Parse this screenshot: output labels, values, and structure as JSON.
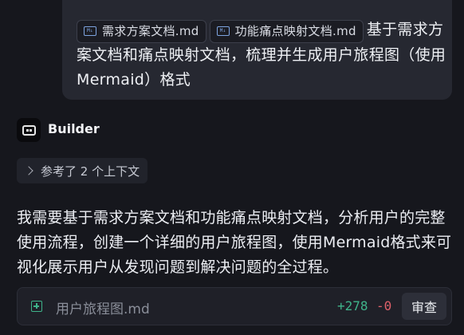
{
  "user_message": {
    "attachments": [
      {
        "icon": "markdown-file-icon",
        "name": "需求方案文档.md"
      },
      {
        "icon": "markdown-file-icon",
        "name": "功能痛点映射文档.md"
      }
    ],
    "text": "基于需求方案文档和痛点映射文档，梳理并生成用户旅程图（使用Mermaid）格式"
  },
  "assistant": {
    "name": "Builder",
    "avatar_icon": "robot-icon",
    "context_label": "参考了 2 个上下文",
    "response": "我需要基于需求方案文档和功能痛点映射文档，分析用户的完整使用流程，创建一个详细的用户旅程图，使用Mermaid格式来可视化展示用户从发现问题到解决问题的全过程。"
  },
  "file_change": {
    "icon": "file-add-icon",
    "filename": "用户旅程图.md",
    "added": "+278",
    "removed": "-0",
    "review_label": "审查"
  },
  "colors": {
    "background": "#16171d",
    "bubble": "#262831",
    "added": "#3fb38a",
    "removed": "#e0606a"
  }
}
